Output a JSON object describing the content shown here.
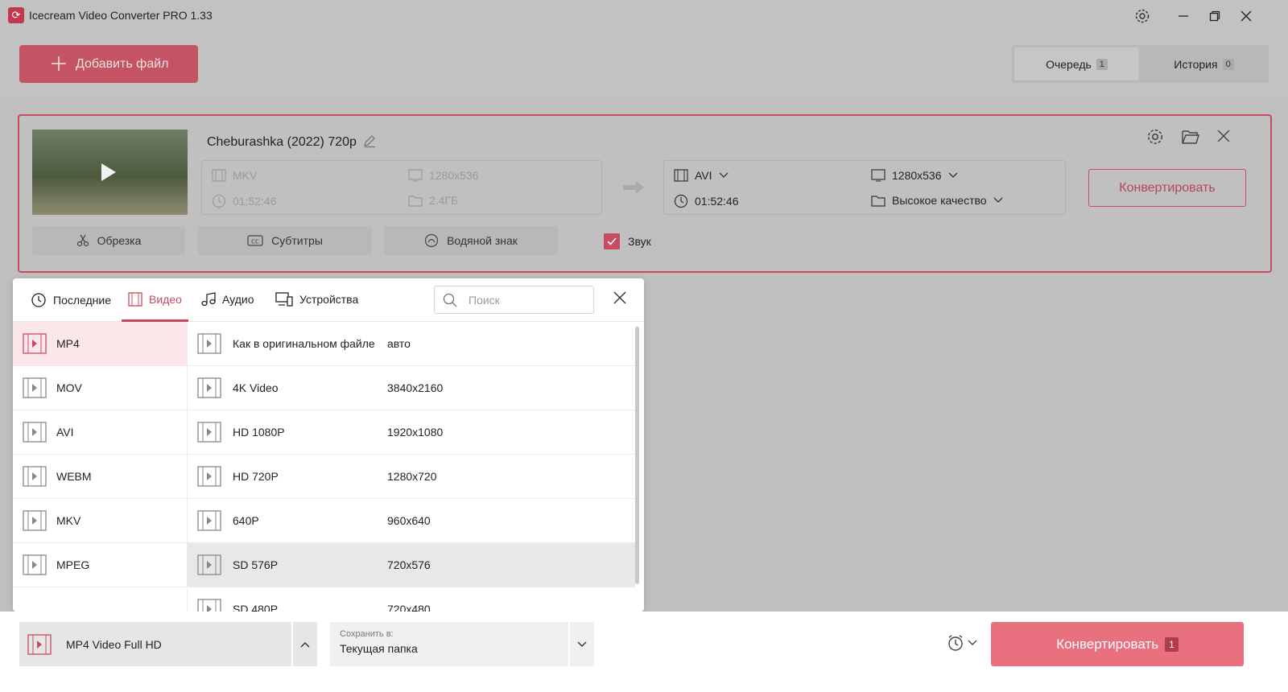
{
  "app": {
    "title": "Icecream Video Converter PRO 1.33"
  },
  "toolbar": {
    "add_file": "Добавить файл",
    "tabs": [
      {
        "label": "Очередь",
        "count": "1"
      },
      {
        "label": "История",
        "count": "0"
      }
    ]
  },
  "file": {
    "name": "Cheburashka (2022) 720p",
    "source": {
      "format": "MKV",
      "resolution": "1280x536",
      "duration": "01:52:46",
      "size": "2.4ГБ"
    },
    "target": {
      "format": "AVI",
      "resolution": "1280x536",
      "duration": "01:52:46",
      "quality": "Высокое качество"
    },
    "convert": "Конвертировать",
    "actions": {
      "trim": "Обрезка",
      "subtitles": "Субтитры",
      "watermark": "Водяной знак",
      "sound": "Звук"
    }
  },
  "popup": {
    "tabs": [
      "Последние",
      "Видео",
      "Аудио",
      "Устройства"
    ],
    "search_placeholder": "Поиск",
    "formats": [
      "MP4",
      "MOV",
      "AVI",
      "WEBM",
      "MKV",
      "MPEG"
    ],
    "presets": [
      {
        "name": "Как в оригинальном файле",
        "res": "авто"
      },
      {
        "name": "4K Video",
        "res": "3840x2160"
      },
      {
        "name": "HD 1080P",
        "res": "1920x1080"
      },
      {
        "name": "HD 720P",
        "res": "1280x720"
      },
      {
        "name": "640P",
        "res": "960x640"
      },
      {
        "name": "SD 576P",
        "res": "720x576"
      },
      {
        "name": "SD 480P",
        "res": "720x480"
      }
    ]
  },
  "bottom": {
    "preset": "MP4 Video Full HD",
    "save_label": "Сохранить в:",
    "save_value": "Текущая папка",
    "convert": "Конвертировать",
    "convert_count": "1"
  },
  "colors": {
    "accent": "#c84c60",
    "convert_bg": "#e9707f"
  }
}
